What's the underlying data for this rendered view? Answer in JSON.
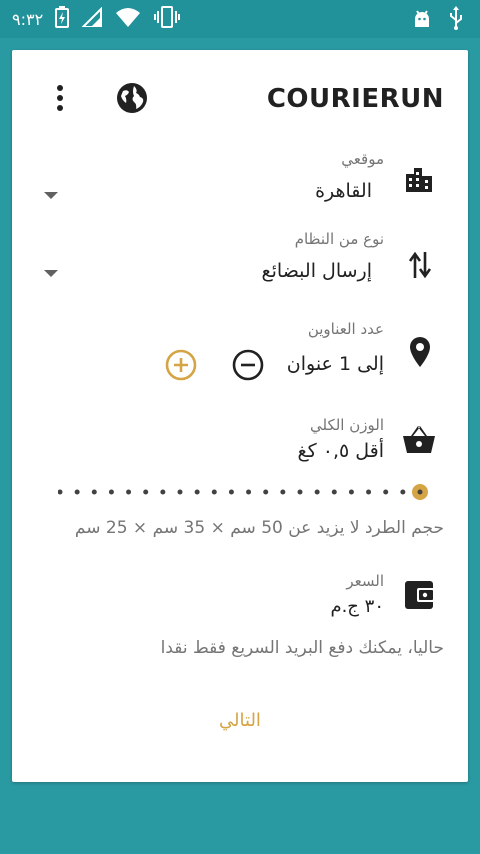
{
  "status_bar": {
    "time": "٩:٣٢",
    "icons": [
      "battery-charging-icon",
      "signal-icon",
      "wifi-icon",
      "vibrate-icon",
      "android-debug-icon",
      "usb-icon"
    ]
  },
  "header": {
    "title": "COURIERUN",
    "icons": [
      "more-vert-icon",
      "globe-icon"
    ]
  },
  "location": {
    "label": "موقعي",
    "value": "القاهرة",
    "icon": "city-icon"
  },
  "system_type": {
    "label": "نوع من النظام",
    "value": "إرسال البضائع",
    "icon": "swap-vertical-icon"
  },
  "addresses": {
    "label": "عدد العناوين",
    "value": "إلى 1 عنوان",
    "icon": "location-pin-icon"
  },
  "weight": {
    "label": "الوزن الكلي",
    "value": "أقل ٠,٥ كغ",
    "icon": "basket-icon",
    "slider_steps": 22,
    "slider_position": 1.0
  },
  "size_note": "حجم الطرد لا يزيد عن 50 سم × 35 سم × 25 سم",
  "price": {
    "label": "السعر",
    "value": "٣٠ ج.م",
    "icon": "wallet-icon"
  },
  "payment_note": "حاليا، يمكنك دفع البريد السريع فقط نقدا",
  "next_label": "التالي",
  "colors": {
    "background": "#2a9aa2",
    "accent": "#d4a445",
    "text": "#212121",
    "secondary_text": "#757575"
  }
}
